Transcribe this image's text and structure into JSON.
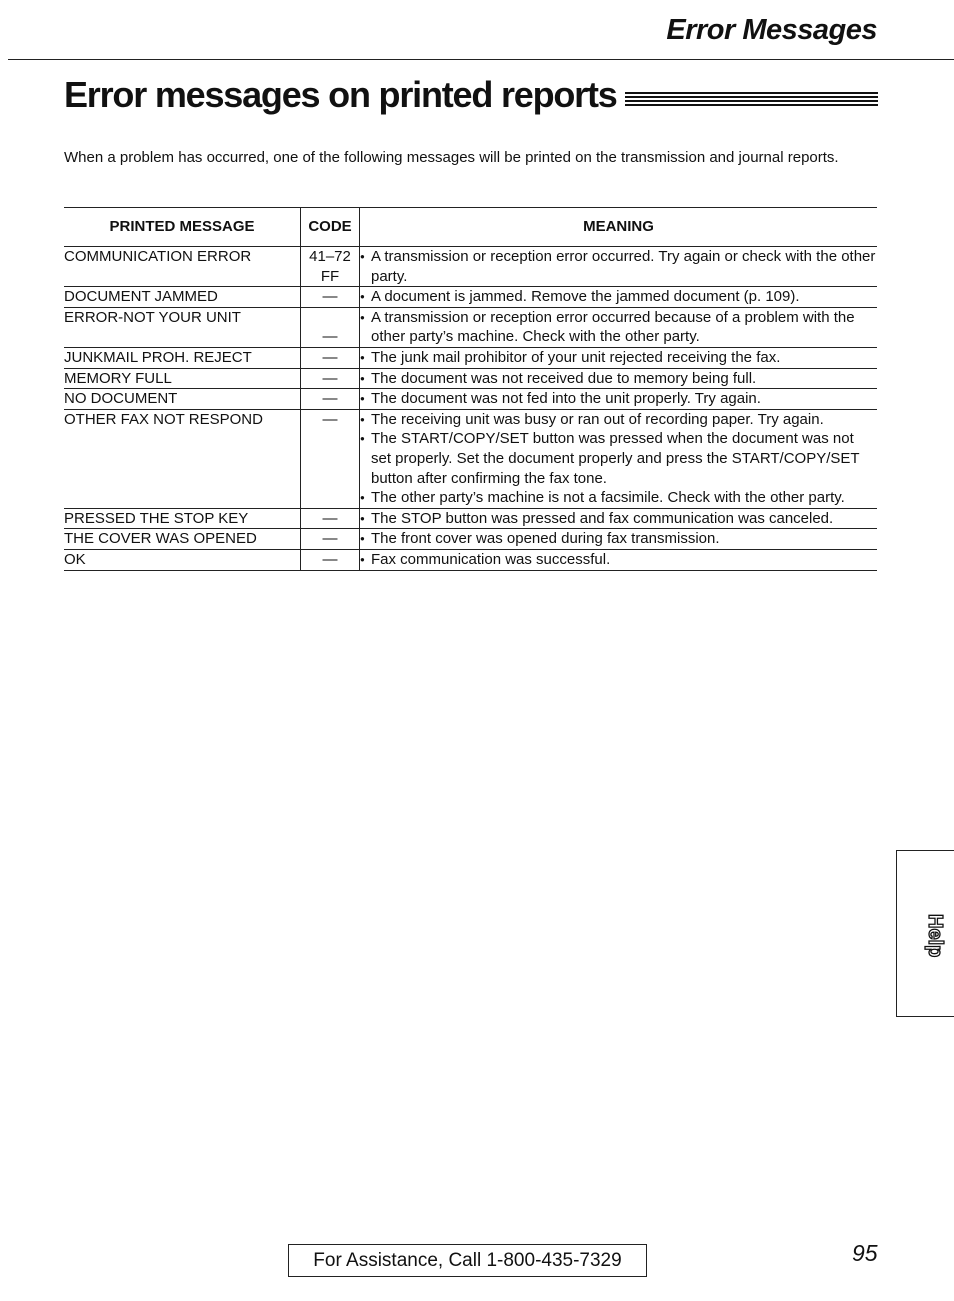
{
  "header": {
    "section": "Error Messages",
    "title": "Error messages on printed reports"
  },
  "intro": "When a problem has occurred, one of the following messages will be printed on the transmission and journal reports.",
  "table": {
    "columns": [
      "PRINTED MESSAGE",
      "CODE",
      "MEANING"
    ],
    "rows": [
      {
        "message": "COMMUNICATION ERROR",
        "code": "41–72\nFF",
        "meaning": [
          "A transmission or reception error occurred. Try again or check with the other party."
        ]
      },
      {
        "message": "DOCUMENT JAMMED",
        "code": "—",
        "meaning": [
          "A document is jammed. Remove the jammed document (p. 109)."
        ]
      },
      {
        "message": "ERROR-NOT YOUR UNIT",
        "code": "—",
        "meaning": [
          "A transmission or reception error occurred because of a problem with the other party’s machine. Check with the other party."
        ]
      },
      {
        "message": "JUNKMAIL PROH. REJECT",
        "code": "—",
        "meaning": [
          "The junk mail prohibitor of your unit rejected receiving the fax."
        ]
      },
      {
        "message": "MEMORY FULL",
        "code": "—",
        "meaning": [
          "The document was not received due to memory being full."
        ]
      },
      {
        "message": "NO DOCUMENT",
        "code": "—",
        "meaning": [
          "The document was not fed into the unit properly. Try again."
        ]
      },
      {
        "message": "OTHER FAX NOT RESPOND",
        "code": "—",
        "meaning": [
          "The receiving unit was busy or ran out of recording paper. Try again.",
          "The START/COPY/SET button was pressed when the document was not set properly. Set the document properly and press the START/COPY/SET button after confirming the fax tone.",
          "The other party’s machine is not a facsimile. Check with the other party."
        ]
      },
      {
        "message": "PRESSED THE STOP KEY",
        "code": "—",
        "meaning": [
          "The STOP button was pressed and fax communication was canceled."
        ]
      },
      {
        "message": "THE COVER WAS OPENED",
        "code": "—",
        "meaning": [
          "The front cover was opened during fax transmission."
        ]
      },
      {
        "message": "OK",
        "code": "—",
        "meaning": [
          "Fax communication was successful."
        ]
      }
    ]
  },
  "side_tab": {
    "label": "Help"
  },
  "footer": {
    "assistance": "For Assistance, Call 1-800-435-7329",
    "page_number": "95"
  }
}
